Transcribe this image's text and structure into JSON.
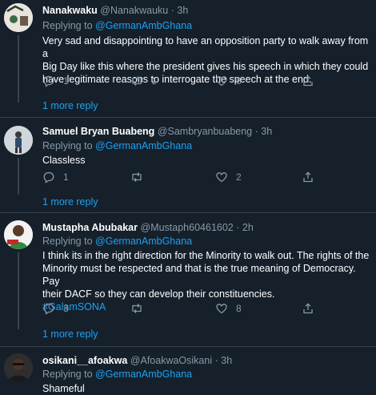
{
  "theme": {
    "background": "#15202b",
    "text": "#ffffff",
    "muted": "#8899a6",
    "accent": "#1da1f2",
    "divider": "#38444d"
  },
  "replying_label": "Replying to",
  "more_replies_label": "1 more reply",
  "tweets": [
    {
      "name": "Nanakwaku",
      "handle": "@Nanakwauku",
      "sep": "·",
      "time": "3h",
      "mention": "@GermanAmbGhana",
      "text_lines": [
        "Very sad and disappointing to have an opposition party to walk away from a",
        "Big Day like this where the president gives his speech in which they could",
        "have legitimate reasons to interrogate the speech at the end."
      ],
      "reply_count": "1",
      "retweet_count": "1",
      "like_count": "6",
      "share_count": ""
    },
    {
      "name": "Samuel Bryan Buabeng",
      "handle": "@Sambryanbuabeng",
      "sep": "·",
      "time": "3h",
      "mention": "@GermanAmbGhana",
      "text_lines": [
        "Classless"
      ],
      "reply_count": "1",
      "retweet_count": "",
      "like_count": "2",
      "share_count": ""
    },
    {
      "name": "Mustapha Abubakar",
      "handle": "@Mustaph60461602",
      "sep": "·",
      "time": "2h",
      "mention": "@GermanAmbGhana",
      "text_lines": [
        "I think its in the right direction for the Minority to walk out. The rights of the",
        "Minority must be respected and that is the true meaning of Democracy. Pay",
        "their DACF so they can develop their constituencies."
      ],
      "hashtag": "#GalamSONA",
      "reply_count": "3",
      "retweet_count": "",
      "like_count": "8",
      "share_count": ""
    },
    {
      "name": "osikani__afoakwa",
      "handle": "@AfoakwaOsikani",
      "sep": "·",
      "time": "3h",
      "mention": "@GermanAmbGhana",
      "text_lines": [
        "Shameful"
      ]
    }
  ]
}
